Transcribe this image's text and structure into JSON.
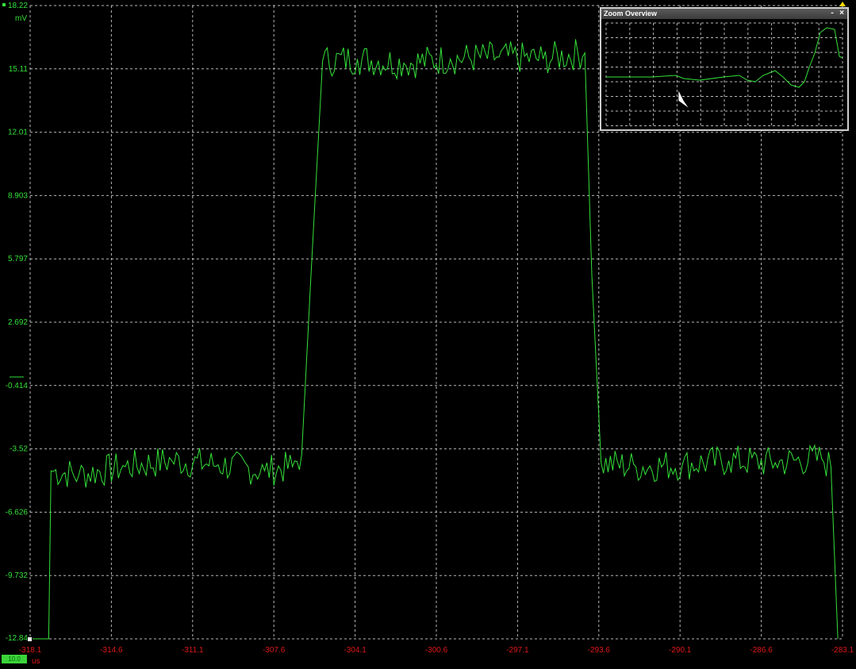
{
  "scope": {
    "y_unit": "mV",
    "x_unit": "us",
    "y_ticks": [
      "18.22",
      "15.11",
      "12.01",
      "8.903",
      "5.797",
      "2.692",
      "-0.414",
      "-3.52",
      "-6.626",
      "-9.732",
      "-12.84"
    ],
    "x_ticks": [
      "-318.1",
      "-314.6",
      "-311.1",
      "-307.6",
      "-304.1",
      "-300.6",
      "-297.1",
      "-293.6",
      "-290.1",
      "-286.6",
      "-283.1"
    ],
    "trace_color": "#35e13a",
    "grid_color": "#d8d8d8",
    "axis_label_color_y": "#35e13a",
    "axis_label_color_x": "#e01818"
  },
  "zoom_overview": {
    "title": "Zoom Overview",
    "minimize_icon": "minimize-icon",
    "close_icon": "close-icon",
    "minimize_label": "-",
    "close_label": "×"
  },
  "bottom_badge": {
    "label": "10.0"
  },
  "chart_data": {
    "type": "line",
    "xlabel": "us",
    "ylabel": "mV",
    "xlim": [
      -318.1,
      -283.1
    ],
    "ylim": [
      -12.84,
      18.22
    ],
    "grid": true,
    "series": [
      {
        "x": [
          -318.1,
          -317.3,
          -317.2,
          -316.0,
          -314.0,
          -312.0,
          -310.0,
          -308.0,
          -306.8,
          -306.4,
          -306.0,
          -305.5,
          -304.0,
          -302.0,
          -300.0,
          -298.0,
          -296.0,
          -294.2,
          -293.9,
          -293.5,
          -292.0,
          -290.0,
          -288.0,
          -286.0,
          -284.0,
          -283.6,
          -283.3
        ],
        "y": [
          -12.84,
          -12.84,
          -4.6,
          -4.8,
          -4.4,
          -4.1,
          -4.3,
          -4.6,
          -4.4,
          -3.8,
          5.0,
          15.5,
          15.6,
          15.4,
          15.6,
          15.7,
          15.6,
          15.9,
          5.0,
          -4.2,
          -4.4,
          -4.3,
          -4.1,
          -4.2,
          -4.0,
          -4.4,
          -12.84
        ]
      }
    ]
  }
}
